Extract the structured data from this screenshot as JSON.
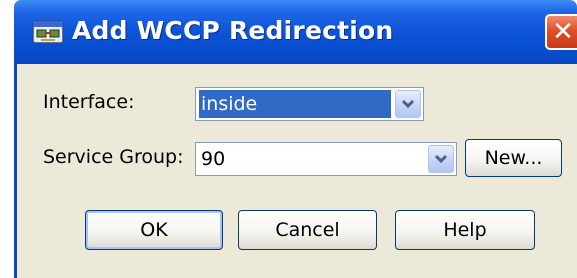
{
  "window": {
    "title": "Add WCCP Redirection",
    "close_label": "✕"
  },
  "form": {
    "interface_label": "Interface:",
    "interface_value": "inside",
    "service_group_label": "Service Group:",
    "service_group_value": "90",
    "new_button_label": "New..."
  },
  "actions": {
    "ok_label": "OK",
    "cancel_label": "Cancel",
    "help_label": "Help"
  },
  "colors": {
    "titlebar": "#0a52d6",
    "client_background": "#ece9d8",
    "selection": "#316ac5",
    "close_button": "#e0502a"
  },
  "icons": {
    "title": "network-window-icon",
    "close": "close-icon",
    "dropdown": "chevron-down-icon"
  }
}
